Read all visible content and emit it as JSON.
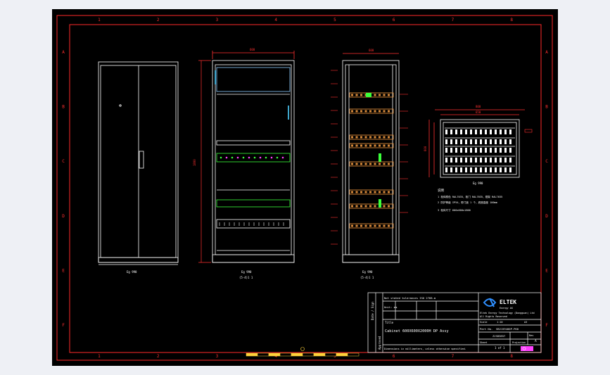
{
  "drawing": {
    "colors": {
      "background": "#000000",
      "frame": "#ff2a2a",
      "line": "#ffffff",
      "dim": "#ff3030",
      "rail": "#d98a3a",
      "accent_green": "#3aff3a",
      "accent_cyan": "#4fd0ff",
      "accent_magenta": "#ff40ff",
      "logo_blue": "#2f8fff"
    },
    "columns": [
      "1",
      "2",
      "3",
      "4",
      "5",
      "6",
      "7",
      "8"
    ],
    "rows": [
      "A",
      "B",
      "C",
      "D",
      "E",
      "F"
    ],
    "view_labels": [
      {
        "label": "Eg 990",
        "sub": ""
      },
      {
        "label": "Eg 990",
        "sub": "(5-4)1 1"
      },
      {
        "label": "Eg 990",
        "sub": "(5-4)1 1"
      },
      {
        "label": "Eg 990",
        "sub": ""
      }
    ],
    "dimensions": {
      "front_width": "600",
      "front_height": "1800",
      "side_width": "600",
      "top_width": "800",
      "top_width_inner": "650",
      "top_depth": "600"
    },
    "notes": {
      "title": "说明",
      "lines": [
        "1  柜体颜色 RAL7035，柜门 RAL7035，框架 RAL7035",
        "2  防护等级 IP54，带门锁 1 个，底座高度 100mm",
        "3  柜体尺寸 600x600x1800"
      ]
    },
    "title_block": {
      "company_logo": "ELTEK",
      "company_sub": "Energy AS",
      "company_lines": [
        "Eltek Energy Technology (Dongguan) Ltd",
        "All Rights Reserved"
      ],
      "remark_1": "Not stated tolerances ISO 2768-m",
      "remark_2": "Unit: mm",
      "title_label": "Title",
      "title": "Cabinet 600X600X2000H  DP Assy",
      "part_no_label": "Part No.",
      "part_no": "SB2159400P-P60",
      "sheet_label": "Sheet",
      "sheet": "1  of  1",
      "rev_label": "Rev",
      "rev": "A",
      "scale_label": "Scale",
      "scale": "1:10",
      "size": "A3",
      "doc_no": "ZJS83857",
      "projection_label": "Projection",
      "footer": "Dimensions in millimeters, unless otherwise specified.",
      "side_labels": [
        "Date / Sign",
        "Approved"
      ]
    }
  }
}
